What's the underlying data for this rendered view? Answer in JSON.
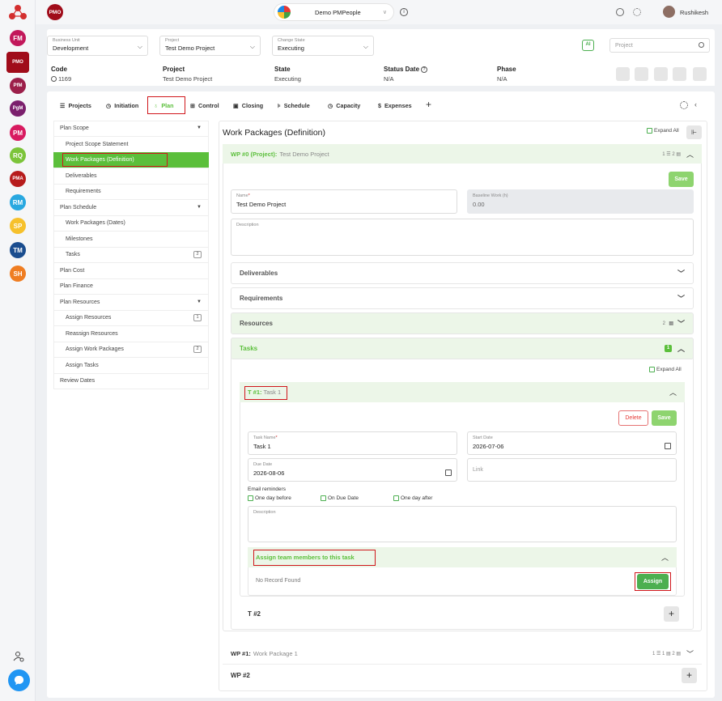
{
  "topbar": {
    "app_badge": "PMO",
    "center_title": "Demo PMPeople",
    "user_name": "Rushikesh"
  },
  "rail": {
    "items": [
      {
        "label": "FM",
        "color": "#c2185b"
      },
      {
        "label": "PMO",
        "color": "#a00c1a"
      },
      {
        "label": "PfM",
        "color": "#9c1f4a"
      },
      {
        "label": "PgM",
        "color": "#7b1f6d"
      },
      {
        "label": "PM",
        "color": "#d81b60"
      },
      {
        "label": "RQ",
        "color": "#7cc43a"
      },
      {
        "label": "PMA",
        "color": "#b71c1c"
      },
      {
        "label": "RM",
        "color": "#29a8e0"
      },
      {
        "label": "SP",
        "color": "#f6c12c"
      },
      {
        "label": "TM",
        "color": "#1a4d8f"
      },
      {
        "label": "SH",
        "color": "#ef7d22"
      }
    ]
  },
  "filters": {
    "business_unit": {
      "label": "Business Unit",
      "value": "Development"
    },
    "project": {
      "label": "Project",
      "value": "Test Demo Project"
    },
    "change_state": {
      "label": "Change State",
      "value": "Executing"
    },
    "search_placeholder": "Project"
  },
  "info": {
    "code_label": "Code",
    "code_value": "1169",
    "project_label": "Project",
    "project_value": "Test Demo Project",
    "state_label": "State",
    "state_value": "Executing",
    "status_date_label": "Status Date",
    "status_date_value": "N/A",
    "phase_label": "Phase",
    "phase_value": "N/A"
  },
  "tabs": [
    {
      "label": "Projects",
      "icon": "list-icon"
    },
    {
      "label": "Initiation",
      "icon": "clock-icon"
    },
    {
      "label": "Plan",
      "icon": "bulb-icon"
    },
    {
      "label": "Control",
      "icon": "control-icon"
    },
    {
      "label": "Closing",
      "icon": "box-icon"
    },
    {
      "label": "Schedule",
      "icon": "schedule-icon"
    },
    {
      "label": "Capacity",
      "icon": "clock-icon"
    },
    {
      "label": "Expenses",
      "icon": "dollar-icon"
    }
  ],
  "nav": {
    "plan_scope": "Plan Scope",
    "project_scope_statement": "Project Scope Statement",
    "work_packages_definition": "Work Packages (Definition)",
    "deliverables": "Deliverables",
    "requirements": "Requirements",
    "plan_schedule": "Plan Schedule",
    "work_packages_dates": "Work Packages (Dates)",
    "milestones": "Milestones",
    "tasks": "Tasks",
    "tasks_badge": "2",
    "plan_cost": "Plan Cost",
    "plan_finance": "Plan Finance",
    "plan_resources": "Plan Resources",
    "assign_resources": "Assign Resources",
    "assign_resources_badge": "1",
    "reassign_resources": "Reassign Resources",
    "assign_work_packages": "Assign Work Packages",
    "assign_work_packages_badge": "2",
    "assign_tasks": "Assign Tasks",
    "review_dates": "Review Dates"
  },
  "main": {
    "title": "Work Packages (Definition)",
    "expand_all": "Expand All",
    "wp0": {
      "prefix": "WP #0 (Project):",
      "name": "Test Demo Project",
      "counts": "1 ☰ 2 ▤",
      "save": "Save",
      "name_label": "Name",
      "name_value": "Test Demo Project",
      "baseline_label": "Baseline Work (h)",
      "baseline_value": "0.00",
      "description_label": "Description",
      "deliverables": "Deliverables",
      "requirements": "Requirements",
      "resources": "Resources",
      "resources_count": "2",
      "tasks": "Tasks",
      "tasks_count": "1"
    },
    "task1": {
      "expand_all": "Expand All",
      "prefix": "T #1:",
      "name": "Task 1",
      "delete": "Delete",
      "save": "Save",
      "task_name_label": "Task Name",
      "task_name_value": "Task 1",
      "start_label": "Start Date",
      "start_value": "2026-07-06",
      "due_label": "Due Date",
      "due_value": "2026-08-06",
      "link_placeholder": "Link",
      "email_reminders": "Email reminders",
      "opt1": "One day before",
      "opt2": "On Due Date",
      "opt3": "One day after",
      "description_label": "Description",
      "assign_header": "Assign team members to this task",
      "no_record": "No Record Found",
      "assign": "Assign"
    },
    "t2": "T #2",
    "wp1": {
      "prefix": "WP #1:",
      "name": "Work Package 1",
      "counts": "1 ☰ 1 ▤ 2 ▤"
    },
    "wp2": "WP #2"
  }
}
